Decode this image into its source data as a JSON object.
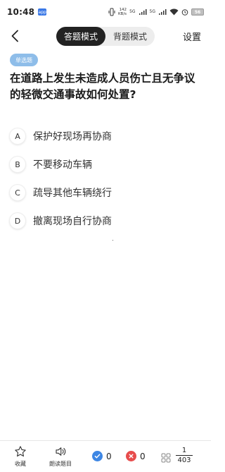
{
  "status_bar": {
    "time": "10:48",
    "app_notification": "app",
    "net_speed_value": "142",
    "net_speed_unit": "KB/s",
    "sig1_label": "5G",
    "sig2_label": "5G",
    "battery": "56"
  },
  "header": {
    "mode_tabs": [
      "答题模式",
      "背题模式"
    ],
    "active_tab": "答题模式",
    "settings": "设置"
  },
  "question": {
    "type_badge": "单选题",
    "text": "在道路上发生未造成人员伤亡且无争议的轻微交通事故如何处置?",
    "options": [
      {
        "letter": "A",
        "text": "保护好现场再协商"
      },
      {
        "letter": "B",
        "text": "不要移动车辆"
      },
      {
        "letter": "C",
        "text": "疏导其他车辆绕行"
      },
      {
        "letter": "D",
        "text": "撤离现场自行协商"
      }
    ]
  },
  "bottom_bar": {
    "favorite_label": "收藏",
    "read_label": "朗读题目",
    "correct_count": "0",
    "wrong_count": "0",
    "current": "1",
    "total": "403"
  },
  "colors": {
    "accent_dark": "#222222",
    "badge_blue": "#8ebde9",
    "correct_blue": "#3d86e4",
    "wrong_red": "#e74c4c"
  },
  "icons": [
    "back-icon",
    "star-icon",
    "speaker-icon",
    "check-icon",
    "cross-icon",
    "grid-icon",
    "wifi-icon",
    "signal-icon",
    "vibrate-icon",
    "alarm-icon"
  ]
}
